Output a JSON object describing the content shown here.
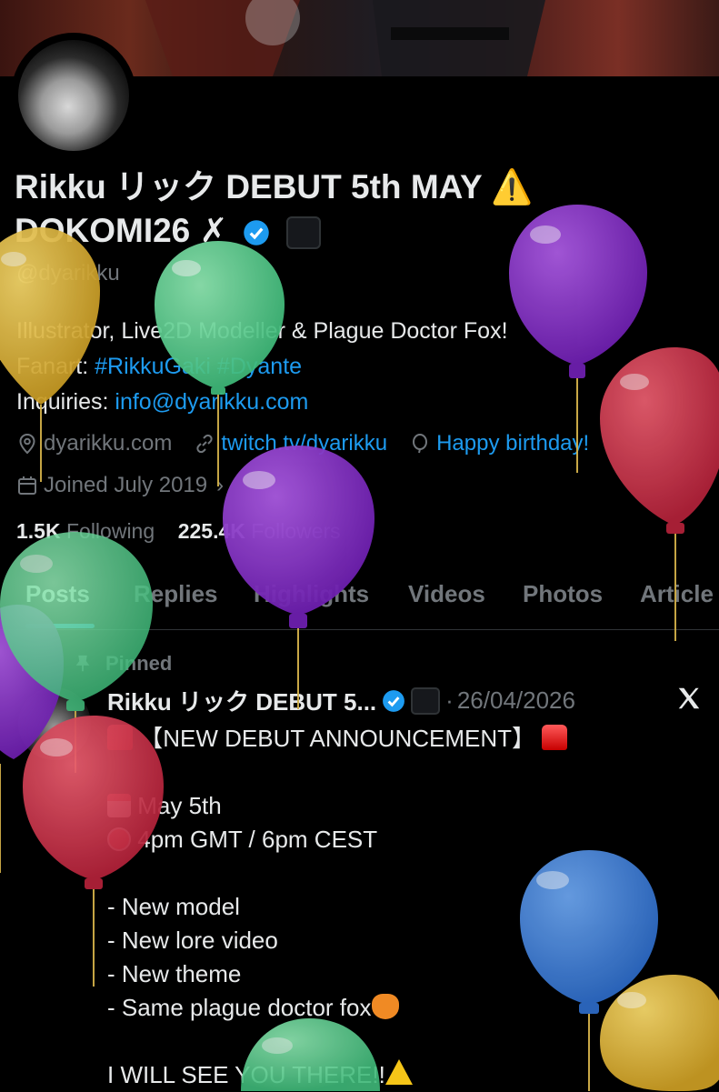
{
  "profile": {
    "display_name": "Rikku リック DEBUT 5th MAY ⚠️",
    "display_name_line2": "DOKOMI26 ✗",
    "handle": "@dyarikku",
    "bio_line1": "Illustrator, Live2D Modeller & Plague Doctor Fox!",
    "bio_fanart_label": "Fanart: ",
    "bio_fanart_tags": "#RikkuGaki #Dyante",
    "bio_inquiries_label": "Inquiries: ",
    "bio_inquiries_email": "info@dyarikku.com",
    "website": "dyarikku.com",
    "twitch": "twitch.tv/dyarikku",
    "birthday": "Happy birthday!",
    "joined": "Joined July 2019",
    "following_count": "1.5K",
    "following_label": "Following",
    "followers_count": "225.4K",
    "followers_label": "Followers"
  },
  "tabs": [
    "Posts",
    "Replies",
    "Highlights",
    "Videos",
    "Photos",
    "Article"
  ],
  "active_tab": "Posts",
  "pinned_post": {
    "pinned_label": "Pinned",
    "author": "Rikku リック DEBUT 5...",
    "separator": "·",
    "date": "26/04/2026",
    "line1": "【NEW DEBUT ANNOUNCEMENT】",
    "line_date": "May 5th",
    "line_time": "4pm GMT / 6pm CEST",
    "line_item1": "- New model",
    "line_item2": "- New lore video",
    "line_item3": "- New theme",
    "line_item4": "- Same plague doctor fox",
    "line_closing": "I WILL SEE YOU THERE!!"
  },
  "icons": {
    "location": "location-icon",
    "link": "link-icon",
    "birthday": "balloon-icon",
    "calendar": "calendar-icon",
    "pin": "pin-icon",
    "verified": "verified-badge-icon",
    "x_logo": "x-logo-icon"
  },
  "colors": {
    "background": "#000000",
    "text": "#e7e9ea",
    "muted": "#71767b",
    "link": "#1d9bf0",
    "balloon_yellow": "#d9b53a",
    "balloon_green": "#5fcf8f",
    "balloon_purple": "#8b2fc9",
    "balloon_red": "#d2344a",
    "balloon_blue": "#3f7fd6"
  }
}
